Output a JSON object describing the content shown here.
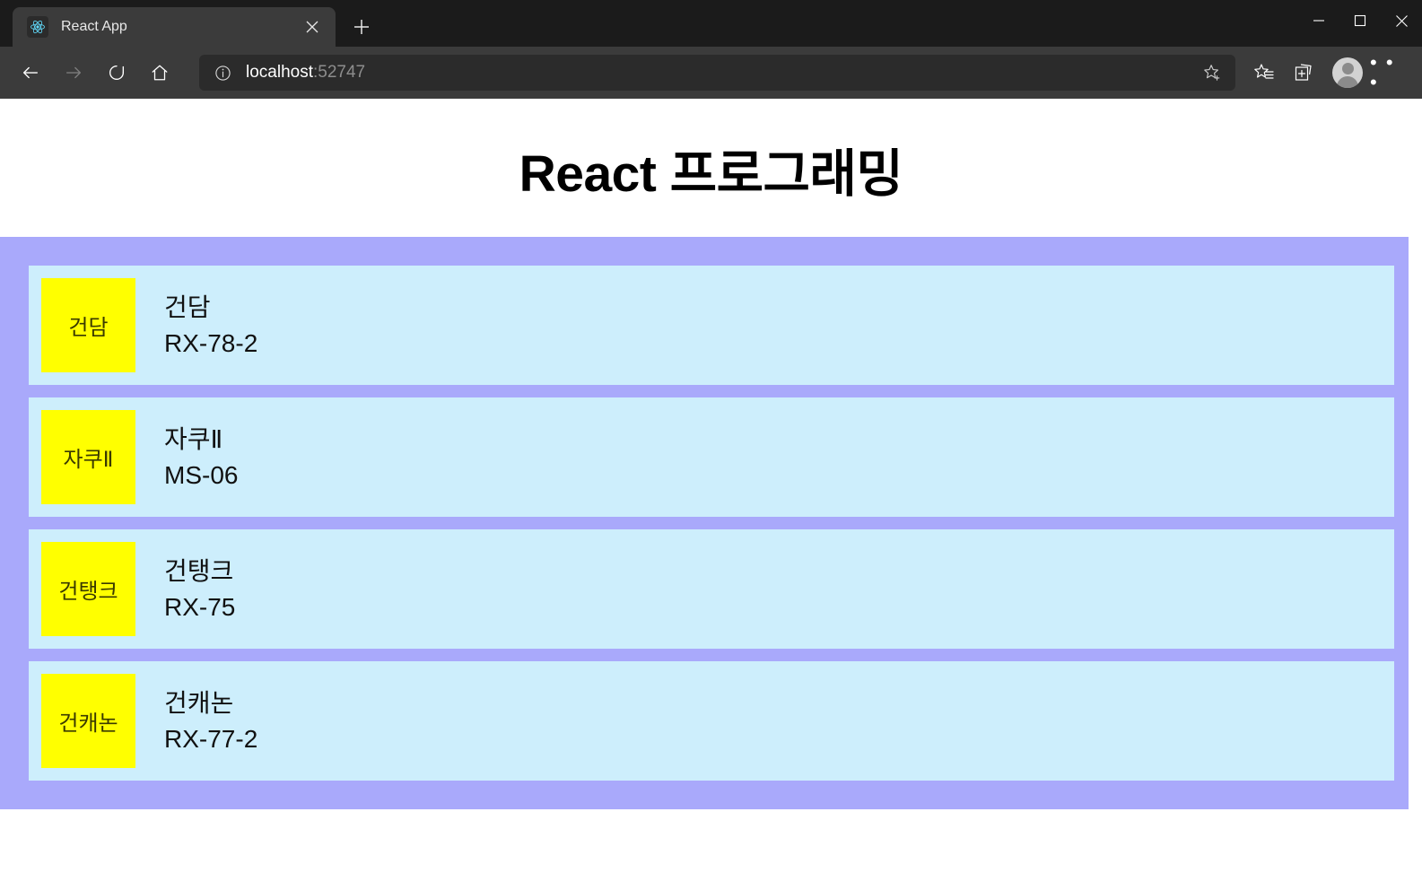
{
  "browser": {
    "tab": {
      "title": "React App",
      "favicon_icon": "react-atom-icon",
      "close_icon": "close-icon"
    },
    "new_tab_icon": "plus-icon",
    "window_controls": [
      {
        "name": "minimize-button",
        "icon": "minimize-icon",
        "glyph": "—"
      },
      {
        "name": "maximize-button",
        "icon": "maximize-icon",
        "glyph": "□"
      },
      {
        "name": "close-window-button",
        "icon": "close-icon",
        "glyph": "✕"
      }
    ],
    "nav": {
      "back_icon": "back-arrow-icon",
      "forward_icon": "forward-arrow-icon",
      "refresh_icon": "refresh-icon",
      "home_icon": "home-icon"
    },
    "omnibox": {
      "info_icon": "info-circle-icon",
      "host": "localhost",
      "port": ":52747",
      "favorite_icon": "star-add-icon"
    },
    "toolbar_right": {
      "favorites_icon": "star-list-icon",
      "collections_icon": "collections-add-icon",
      "profile_icon": "account-avatar-icon",
      "settings_icon": "ellipsis-icon",
      "settings_glyph": "• • •"
    }
  },
  "page": {
    "title": "React 프로그래밍",
    "colors": {
      "container_bg": "#a9a9fb",
      "item_bg": "#cdeefc",
      "thumb_bg": "#ffff00",
      "text": "#111111"
    },
    "items": [
      {
        "thumb_label": "건담",
        "name": "건담",
        "code": "RX-78-2"
      },
      {
        "thumb_label": "자쿠Ⅱ",
        "name": "자쿠Ⅱ",
        "code": "MS-06"
      },
      {
        "thumb_label": "건탱크",
        "name": "건탱크",
        "code": "RX-75"
      },
      {
        "thumb_label": "건캐논",
        "name": "건캐논",
        "code": "RX-77-2"
      }
    ]
  }
}
